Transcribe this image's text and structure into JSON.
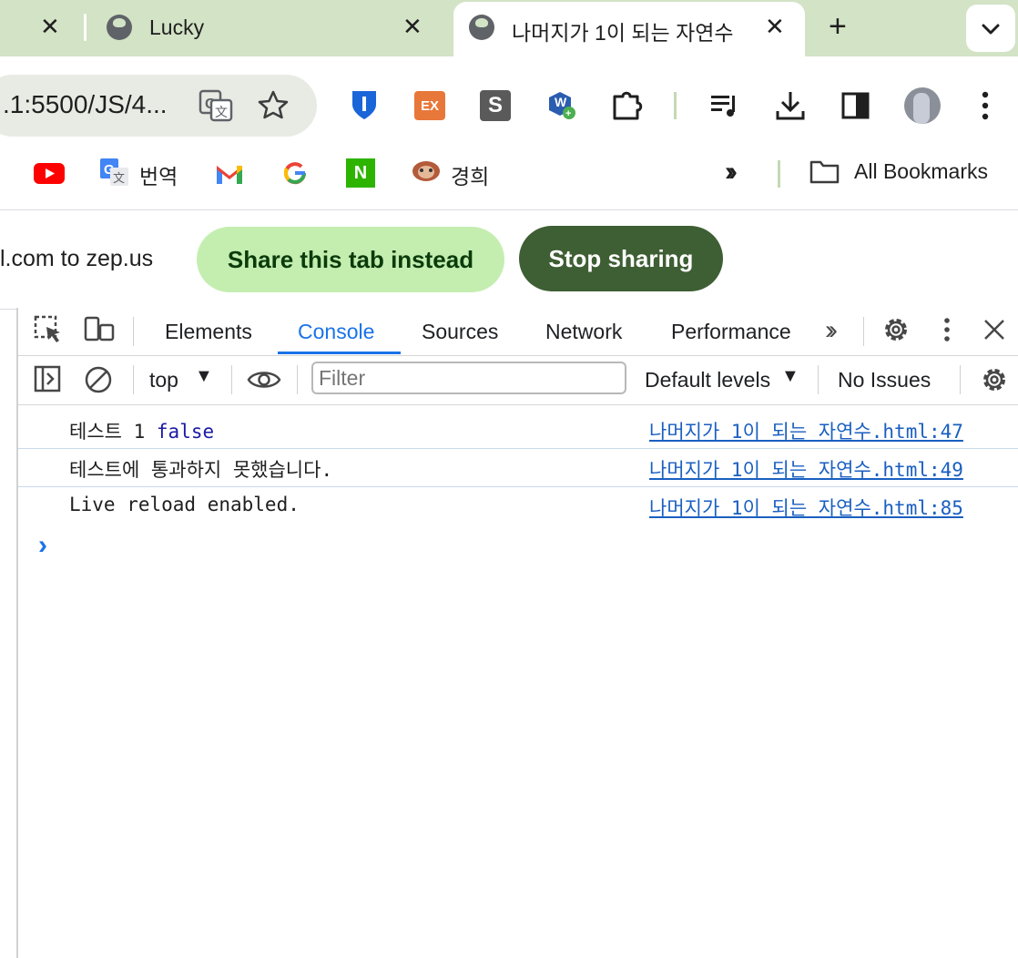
{
  "tabs": [
    {
      "title": "",
      "active": false
    },
    {
      "title": "Lucky",
      "active": false
    },
    {
      "title": "나머지가 1이 되는 자연수",
      "active": true
    }
  ],
  "toolbar": {
    "url": ".1:5500/JS/4...",
    "colors": {
      "shield": "#1a66d9",
      "ex": "#e8773a",
      "s": "#5a5a5a"
    }
  },
  "extensions": {
    "ex_label": "EX",
    "s_label": "S",
    "w_label": "W"
  },
  "bookmarks": {
    "items": [
      {
        "label": "",
        "icon": "youtube-icon"
      },
      {
        "label": "번역",
        "icon": "google-translate-icon"
      },
      {
        "label": "",
        "icon": "gmail-icon"
      },
      {
        "label": "",
        "icon": "google-icon"
      },
      {
        "label": "",
        "icon": "naver-icon"
      },
      {
        "label": "경희",
        "icon": "khu-icon"
      }
    ],
    "naver_letter": "N",
    "all_bookmarks": "All Bookmarks"
  },
  "share_bar": {
    "text": "l.com to zep.us",
    "share_tab_label": "Share this tab instead",
    "stop_label": "Stop sharing"
  },
  "devtools": {
    "tabs": [
      "Elements",
      "Console",
      "Sources",
      "Network",
      "Performance"
    ],
    "active_tab": "Console",
    "context": "top",
    "filter_placeholder": "Filter",
    "levels": "Default levels",
    "issues": "No Issues"
  },
  "console": {
    "messages": [
      {
        "text": "테스트 1",
        "value": "false",
        "source": "나머지가 1이 되는 자연수.html:47"
      },
      {
        "text": "테스트에 통과하지 못했습니다.",
        "value": "",
        "source": "나머지가 1이 되는 자연수.html:49"
      },
      {
        "text": "Live reload enabled.",
        "value": "",
        "source": "나머지가 1이 되는 자연수.html:85"
      }
    ],
    "prompt": "›"
  }
}
